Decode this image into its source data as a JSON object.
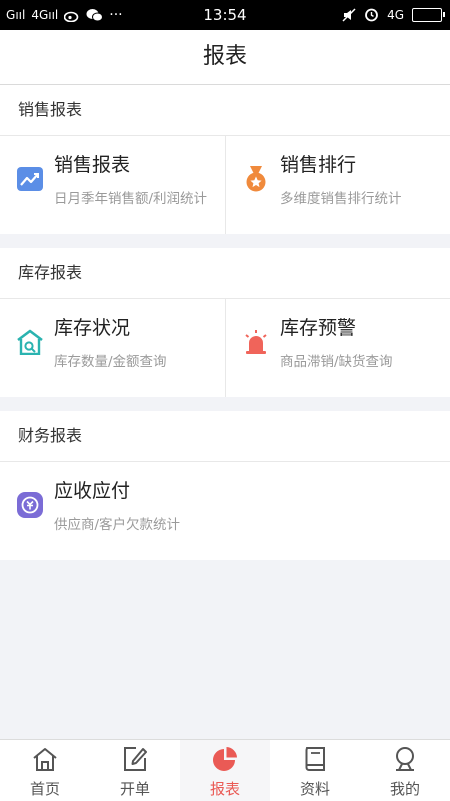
{
  "status_bar": {
    "carrier_left": "G",
    "net1": "4G",
    "time": "13:54",
    "net2": "4G"
  },
  "header": {
    "title": "报表"
  },
  "sections": [
    {
      "title": "销售报表",
      "items": [
        {
          "title": "销售报表",
          "desc": "日月季年销售额/利润统计",
          "icon": "trend-chart-icon",
          "color": "#5b8ee6"
        },
        {
          "title": "销售排行",
          "desc": "多维度销售排行统计",
          "icon": "medal-icon",
          "color": "#f08a3c"
        }
      ]
    },
    {
      "title": "库存报表",
      "items": [
        {
          "title": "库存状况",
          "desc": "库存数量/金额查询",
          "icon": "warehouse-icon",
          "color": "#2ab3b0"
        },
        {
          "title": "库存预警",
          "desc": "商品滞销/缺货查询",
          "icon": "alarm-light-icon",
          "color": "#f0645a"
        }
      ]
    },
    {
      "title": "财务报表",
      "items": [
        {
          "title": "应收应付",
          "desc": "供应商/客户欠款统计",
          "icon": "money-exchange-icon",
          "color": "#7b6cd6"
        }
      ]
    }
  ],
  "tabbar": [
    {
      "label": "首页",
      "icon": "home-icon",
      "active": false
    },
    {
      "label": "开单",
      "icon": "edit-icon",
      "active": false
    },
    {
      "label": "报表",
      "icon": "pie-chart-icon",
      "active": true
    },
    {
      "label": "资料",
      "icon": "book-icon",
      "active": false
    },
    {
      "label": "我的",
      "icon": "user-icon",
      "active": false
    }
  ],
  "colors": {
    "accent": "#ea5a55",
    "muted": "#9a9a9a"
  }
}
